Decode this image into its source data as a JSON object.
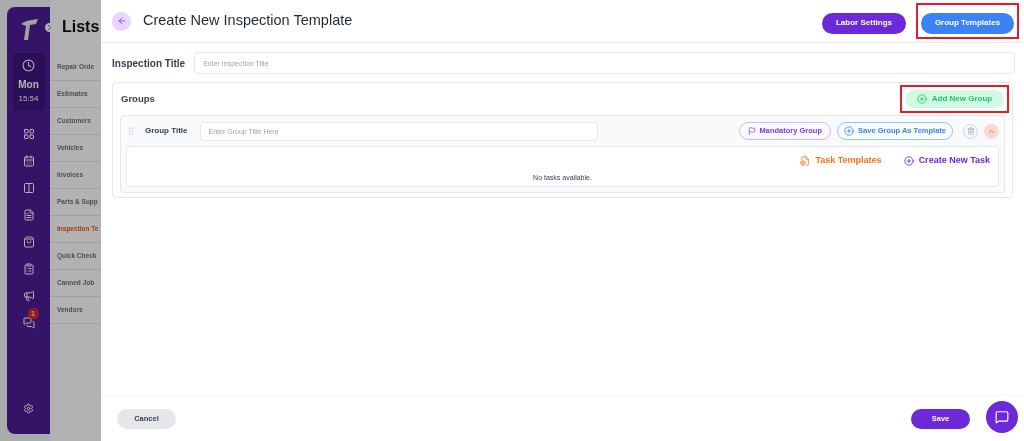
{
  "sidebar": {
    "day": "Mon",
    "time": "15:54",
    "chat_badge": "1"
  },
  "lists": {
    "title": "Lists",
    "items": [
      {
        "label": "Repair Orde",
        "selected": false
      },
      {
        "label": "Estimates",
        "selected": false
      },
      {
        "label": "Customers",
        "selected": false
      },
      {
        "label": "Vehicles",
        "selected": false
      },
      {
        "label": "Invoices",
        "selected": false
      },
      {
        "label": "Parts & Supp",
        "selected": false
      },
      {
        "label": "Inspection Te",
        "selected": true
      },
      {
        "label": "Quick Check",
        "selected": false
      },
      {
        "label": "Canned Job",
        "selected": false
      },
      {
        "label": "Vendors",
        "selected": false
      }
    ]
  },
  "drawer": {
    "title": "Create New Inspection Template",
    "header_buttons": [
      {
        "label": "Labor Settings",
        "kind": "purple",
        "highlighted": false
      },
      {
        "label": "Group Templates",
        "kind": "blue",
        "highlighted": true
      }
    ],
    "inspection_title": {
      "label": "Inspection Title",
      "placeholder": "Enter Inspection Title"
    },
    "groups": {
      "title": "Groups",
      "add_button": {
        "label": "Add New Group",
        "highlighted": true
      },
      "items": [
        {
          "label": "Group Title",
          "placeholder": "Enter Group Title Here",
          "mandatory_label": "Mandatory Group",
          "save_template_label": "Save Group As Template",
          "expanded": true,
          "task_templates_label": "Task Templates",
          "create_task_label": "Create New Task",
          "empty_text": "No tasks available."
        }
      ]
    },
    "footer": {
      "cancel": "Cancel",
      "save": "Save"
    }
  }
}
